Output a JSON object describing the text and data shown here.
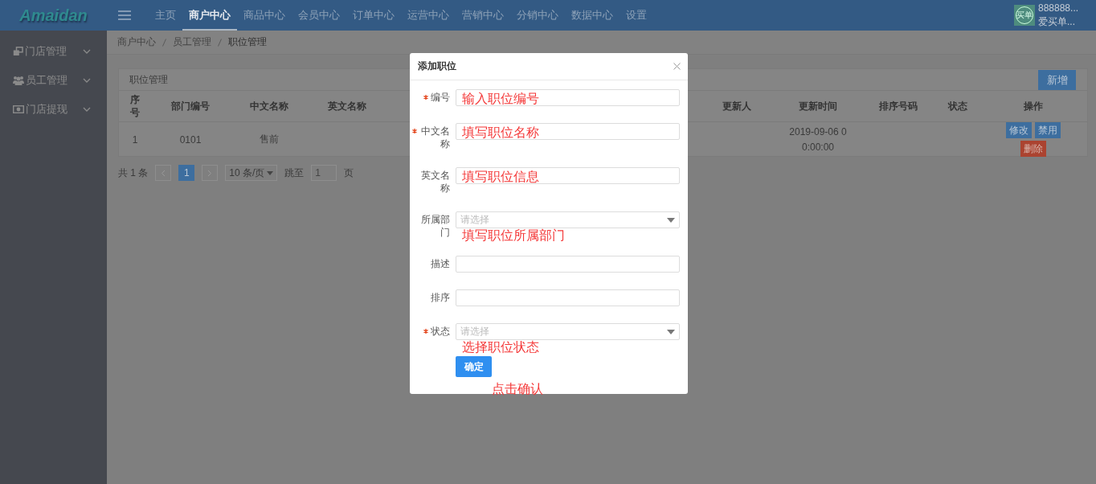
{
  "header": {
    "logo": "Amaidan",
    "nav": [
      {
        "label": "主页",
        "selected": false
      },
      {
        "label": "商户中心",
        "selected": true
      },
      {
        "label": "商品中心",
        "selected": false
      },
      {
        "label": "会员中心",
        "selected": false
      },
      {
        "label": "订单中心",
        "selected": false
      },
      {
        "label": "运营中心",
        "selected": false
      },
      {
        "label": "营销中心",
        "selected": false
      },
      {
        "label": "分销中心",
        "selected": false
      },
      {
        "label": "数据中心",
        "selected": false
      },
      {
        "label": "设置",
        "selected": false
      }
    ],
    "user": {
      "avatar_text": "买单",
      "id": "888888...",
      "name": "爱买单..."
    }
  },
  "sidebar": {
    "items": [
      {
        "label": "门店管理",
        "expanded": false
      },
      {
        "label": "员工管理",
        "expanded": false
      },
      {
        "label": "门店提现",
        "expanded": false
      }
    ]
  },
  "breadcrumb": [
    "商户中心",
    "员工管理",
    "职位管理"
  ],
  "panel": {
    "title": "职位管理",
    "add_button": "新增"
  },
  "table": {
    "columns": [
      "序号",
      "部门编号",
      "中文名称",
      "英文名称",
      "更新人",
      "更新时间",
      "排序号码",
      "状态",
      "操作"
    ],
    "rows": [
      {
        "index": "1",
        "dept_code": "0101",
        "cn_name": "售前",
        "updated_at": "2019-09-06 00:00:00",
        "actions": [
          {
            "label": "修改",
            "kind": "primary"
          },
          {
            "label": "禁用",
            "kind": "primary"
          },
          {
            "label": "删除",
            "kind": "danger"
          }
        ]
      }
    ]
  },
  "pagination": {
    "total": "共 1 条",
    "pages": [
      {
        "label": "1",
        "selected": true
      }
    ],
    "page_size": "10 条/页",
    "jump_label": "跳至",
    "jump_value": "1",
    "page_suffix": "页"
  },
  "modal": {
    "title": "添加职位",
    "fields": [
      {
        "label": "编号",
        "required": true,
        "kind": "input",
        "annotation": "输入职位编号"
      },
      {
        "label": "中文名称",
        "required": true,
        "kind": "input",
        "annotation": "填写职位名称"
      },
      {
        "label": "英文名称",
        "required": false,
        "kind": "input",
        "annotation": "填写职位信息"
      },
      {
        "label": "所属部门",
        "required": false,
        "kind": "select",
        "placeholder": "请选择",
        "annotation": "填写职位所属部门"
      },
      {
        "label": "描述",
        "required": false,
        "kind": "input"
      },
      {
        "label": "排序",
        "required": false,
        "kind": "input"
      },
      {
        "label": "状态",
        "required": true,
        "kind": "select",
        "placeholder": "请选择",
        "annotation": "选择职位状态"
      }
    ],
    "submit": "确定",
    "submit_annotation": "点击确认"
  }
}
